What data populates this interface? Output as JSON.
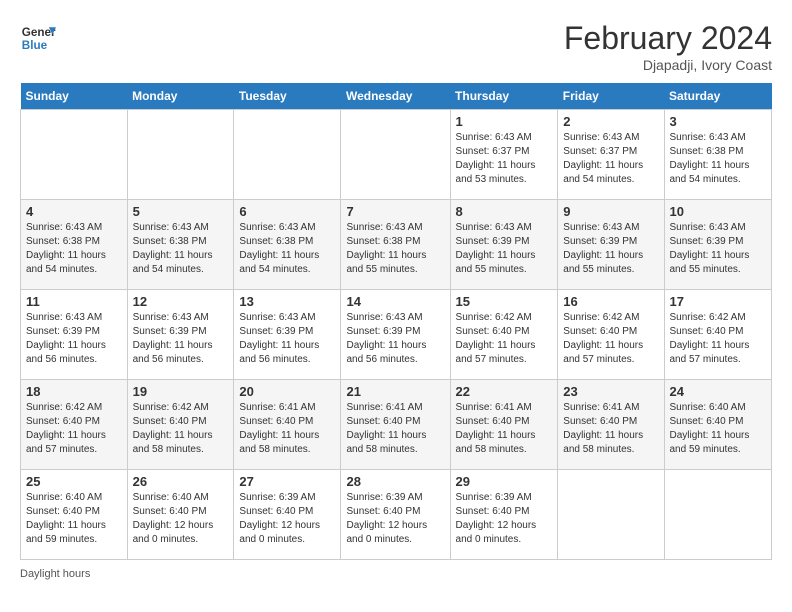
{
  "header": {
    "logo_line1": "General",
    "logo_line2": "Blue",
    "month": "February 2024",
    "location": "Djapadji, Ivory Coast"
  },
  "days_of_week": [
    "Sunday",
    "Monday",
    "Tuesday",
    "Wednesday",
    "Thursday",
    "Friday",
    "Saturday"
  ],
  "weeks": [
    [
      {
        "num": "",
        "info": ""
      },
      {
        "num": "",
        "info": ""
      },
      {
        "num": "",
        "info": ""
      },
      {
        "num": "",
        "info": ""
      },
      {
        "num": "1",
        "info": "Sunrise: 6:43 AM\nSunset: 6:37 PM\nDaylight: 11 hours\nand 53 minutes."
      },
      {
        "num": "2",
        "info": "Sunrise: 6:43 AM\nSunset: 6:37 PM\nDaylight: 11 hours\nand 54 minutes."
      },
      {
        "num": "3",
        "info": "Sunrise: 6:43 AM\nSunset: 6:38 PM\nDaylight: 11 hours\nand 54 minutes."
      }
    ],
    [
      {
        "num": "4",
        "info": "Sunrise: 6:43 AM\nSunset: 6:38 PM\nDaylight: 11 hours\nand 54 minutes."
      },
      {
        "num": "5",
        "info": "Sunrise: 6:43 AM\nSunset: 6:38 PM\nDaylight: 11 hours\nand 54 minutes."
      },
      {
        "num": "6",
        "info": "Sunrise: 6:43 AM\nSunset: 6:38 PM\nDaylight: 11 hours\nand 54 minutes."
      },
      {
        "num": "7",
        "info": "Sunrise: 6:43 AM\nSunset: 6:38 PM\nDaylight: 11 hours\nand 55 minutes."
      },
      {
        "num": "8",
        "info": "Sunrise: 6:43 AM\nSunset: 6:39 PM\nDaylight: 11 hours\nand 55 minutes."
      },
      {
        "num": "9",
        "info": "Sunrise: 6:43 AM\nSunset: 6:39 PM\nDaylight: 11 hours\nand 55 minutes."
      },
      {
        "num": "10",
        "info": "Sunrise: 6:43 AM\nSunset: 6:39 PM\nDaylight: 11 hours\nand 55 minutes."
      }
    ],
    [
      {
        "num": "11",
        "info": "Sunrise: 6:43 AM\nSunset: 6:39 PM\nDaylight: 11 hours\nand 56 minutes."
      },
      {
        "num": "12",
        "info": "Sunrise: 6:43 AM\nSunset: 6:39 PM\nDaylight: 11 hours\nand 56 minutes."
      },
      {
        "num": "13",
        "info": "Sunrise: 6:43 AM\nSunset: 6:39 PM\nDaylight: 11 hours\nand 56 minutes."
      },
      {
        "num": "14",
        "info": "Sunrise: 6:43 AM\nSunset: 6:39 PM\nDaylight: 11 hours\nand 56 minutes."
      },
      {
        "num": "15",
        "info": "Sunrise: 6:42 AM\nSunset: 6:40 PM\nDaylight: 11 hours\nand 57 minutes."
      },
      {
        "num": "16",
        "info": "Sunrise: 6:42 AM\nSunset: 6:40 PM\nDaylight: 11 hours\nand 57 minutes."
      },
      {
        "num": "17",
        "info": "Sunrise: 6:42 AM\nSunset: 6:40 PM\nDaylight: 11 hours\nand 57 minutes."
      }
    ],
    [
      {
        "num": "18",
        "info": "Sunrise: 6:42 AM\nSunset: 6:40 PM\nDaylight: 11 hours\nand 57 minutes."
      },
      {
        "num": "19",
        "info": "Sunrise: 6:42 AM\nSunset: 6:40 PM\nDaylight: 11 hours\nand 58 minutes."
      },
      {
        "num": "20",
        "info": "Sunrise: 6:41 AM\nSunset: 6:40 PM\nDaylight: 11 hours\nand 58 minutes."
      },
      {
        "num": "21",
        "info": "Sunrise: 6:41 AM\nSunset: 6:40 PM\nDaylight: 11 hours\nand 58 minutes."
      },
      {
        "num": "22",
        "info": "Sunrise: 6:41 AM\nSunset: 6:40 PM\nDaylight: 11 hours\nand 58 minutes."
      },
      {
        "num": "23",
        "info": "Sunrise: 6:41 AM\nSunset: 6:40 PM\nDaylight: 11 hours\nand 58 minutes."
      },
      {
        "num": "24",
        "info": "Sunrise: 6:40 AM\nSunset: 6:40 PM\nDaylight: 11 hours\nand 59 minutes."
      }
    ],
    [
      {
        "num": "25",
        "info": "Sunrise: 6:40 AM\nSunset: 6:40 PM\nDaylight: 11 hours\nand 59 minutes."
      },
      {
        "num": "26",
        "info": "Sunrise: 6:40 AM\nSunset: 6:40 PM\nDaylight: 12 hours\nand 0 minutes."
      },
      {
        "num": "27",
        "info": "Sunrise: 6:39 AM\nSunset: 6:40 PM\nDaylight: 12 hours\nand 0 minutes."
      },
      {
        "num": "28",
        "info": "Sunrise: 6:39 AM\nSunset: 6:40 PM\nDaylight: 12 hours\nand 0 minutes."
      },
      {
        "num": "29",
        "info": "Sunrise: 6:39 AM\nSunset: 6:40 PM\nDaylight: 12 hours\nand 0 minutes."
      },
      {
        "num": "",
        "info": ""
      },
      {
        "num": "",
        "info": ""
      }
    ]
  ],
  "footer": {
    "daylight_label": "Daylight hours"
  }
}
